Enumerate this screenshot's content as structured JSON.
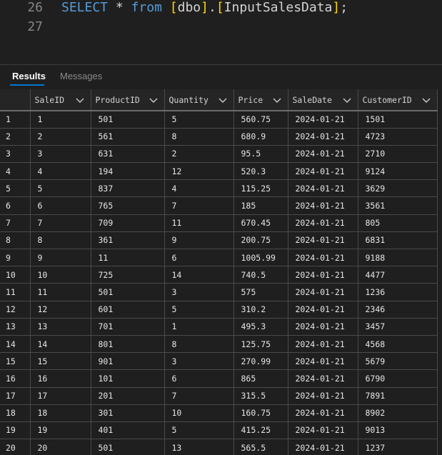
{
  "editor": {
    "lines": [
      {
        "number": "26",
        "keyword_select": "SELECT",
        "star": "*",
        "keyword_from": "from",
        "schema": "dbo",
        "table": "InputSalesData",
        "terminator": ";"
      },
      {
        "number": "27"
      }
    ]
  },
  "tabs": [
    {
      "label": "Results",
      "active": true
    },
    {
      "label": "Messages",
      "active": false
    }
  ],
  "grid": {
    "columns": [
      "SaleID",
      "ProductID",
      "Quantity",
      "Price",
      "SaleDate",
      "CustomerID"
    ],
    "rows": [
      [
        "1",
        "1",
        "501",
        "5",
        "560.75",
        "2024-01-21",
        "1501"
      ],
      [
        "2",
        "2",
        "561",
        "8",
        "680.9",
        "2024-01-21",
        "4723"
      ],
      [
        "3",
        "3",
        "631",
        "2",
        "95.5",
        "2024-01-21",
        "2710"
      ],
      [
        "4",
        "4",
        "194",
        "12",
        "520.3",
        "2024-01-21",
        "9124"
      ],
      [
        "5",
        "5",
        "837",
        "4",
        "115.25",
        "2024-01-21",
        "3629"
      ],
      [
        "6",
        "6",
        "765",
        "7",
        "185",
        "2024-01-21",
        "3561"
      ],
      [
        "7",
        "7",
        "709",
        "11",
        "670.45",
        "2024-01-21",
        "805"
      ],
      [
        "8",
        "8",
        "361",
        "9",
        "200.75",
        "2024-01-21",
        "6831"
      ],
      [
        "9",
        "9",
        "11",
        "6",
        "1005.99",
        "2024-01-21",
        "9188"
      ],
      [
        "10",
        "10",
        "725",
        "14",
        "740.5",
        "2024-01-21",
        "4477"
      ],
      [
        "11",
        "11",
        "501",
        "3",
        "575",
        "2024-01-21",
        "1236"
      ],
      [
        "12",
        "12",
        "601",
        "5",
        "310.2",
        "2024-01-21",
        "2346"
      ],
      [
        "13",
        "13",
        "701",
        "1",
        "495.3",
        "2024-01-21",
        "3457"
      ],
      [
        "14",
        "14",
        "801",
        "8",
        "125.75",
        "2024-01-21",
        "4568"
      ],
      [
        "15",
        "15",
        "901",
        "3",
        "270.99",
        "2024-01-21",
        "5679"
      ],
      [
        "16",
        "16",
        "101",
        "6",
        "865",
        "2024-01-21",
        "6790"
      ],
      [
        "17",
        "17",
        "201",
        "7",
        "315.5",
        "2024-01-21",
        "7891"
      ],
      [
        "18",
        "18",
        "301",
        "10",
        "160.75",
        "2024-01-21",
        "8902"
      ],
      [
        "19",
        "19",
        "401",
        "5",
        "415.25",
        "2024-01-21",
        "9013"
      ],
      [
        "20",
        "20",
        "501",
        "13",
        "565.5",
        "2024-01-21",
        "1237"
      ]
    ]
  },
  "colors": {
    "keyword": "#569cd6",
    "bracket": "#ffd700",
    "accent": "#0078d4",
    "background": "#1f1f1f"
  },
  "icons": {
    "column_sort": "chevron-down-icon"
  }
}
